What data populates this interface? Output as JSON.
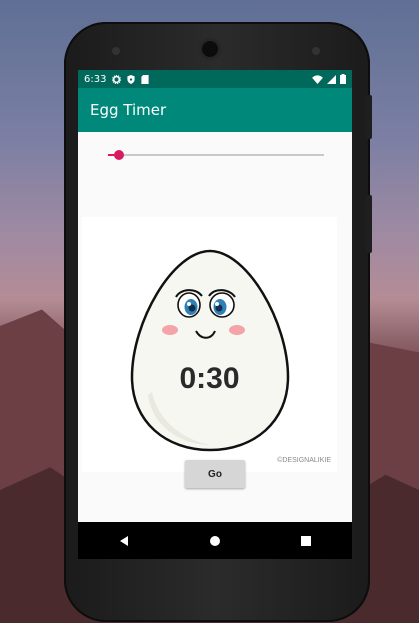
{
  "status_bar": {
    "time": "6:33",
    "icons_left": [
      "gear-icon",
      "shield-icon",
      "sd-card-icon"
    ],
    "icons_right": [
      "wifi-icon",
      "signal-icon",
      "battery-icon"
    ]
  },
  "app_bar": {
    "title": "Egg Timer"
  },
  "slider": {
    "value_fraction": 0.05,
    "accent_color": "#d81b60"
  },
  "egg": {
    "timer": "0:30",
    "credit": "©DESIGNALIKIE"
  },
  "go_button": {
    "label": "Go"
  },
  "nav_bar": {
    "icons": [
      "back-icon",
      "home-icon",
      "recents-icon"
    ]
  },
  "colors": {
    "status_bar": "#00695c",
    "app_bar": "#00897b",
    "accent": "#d81b60"
  }
}
